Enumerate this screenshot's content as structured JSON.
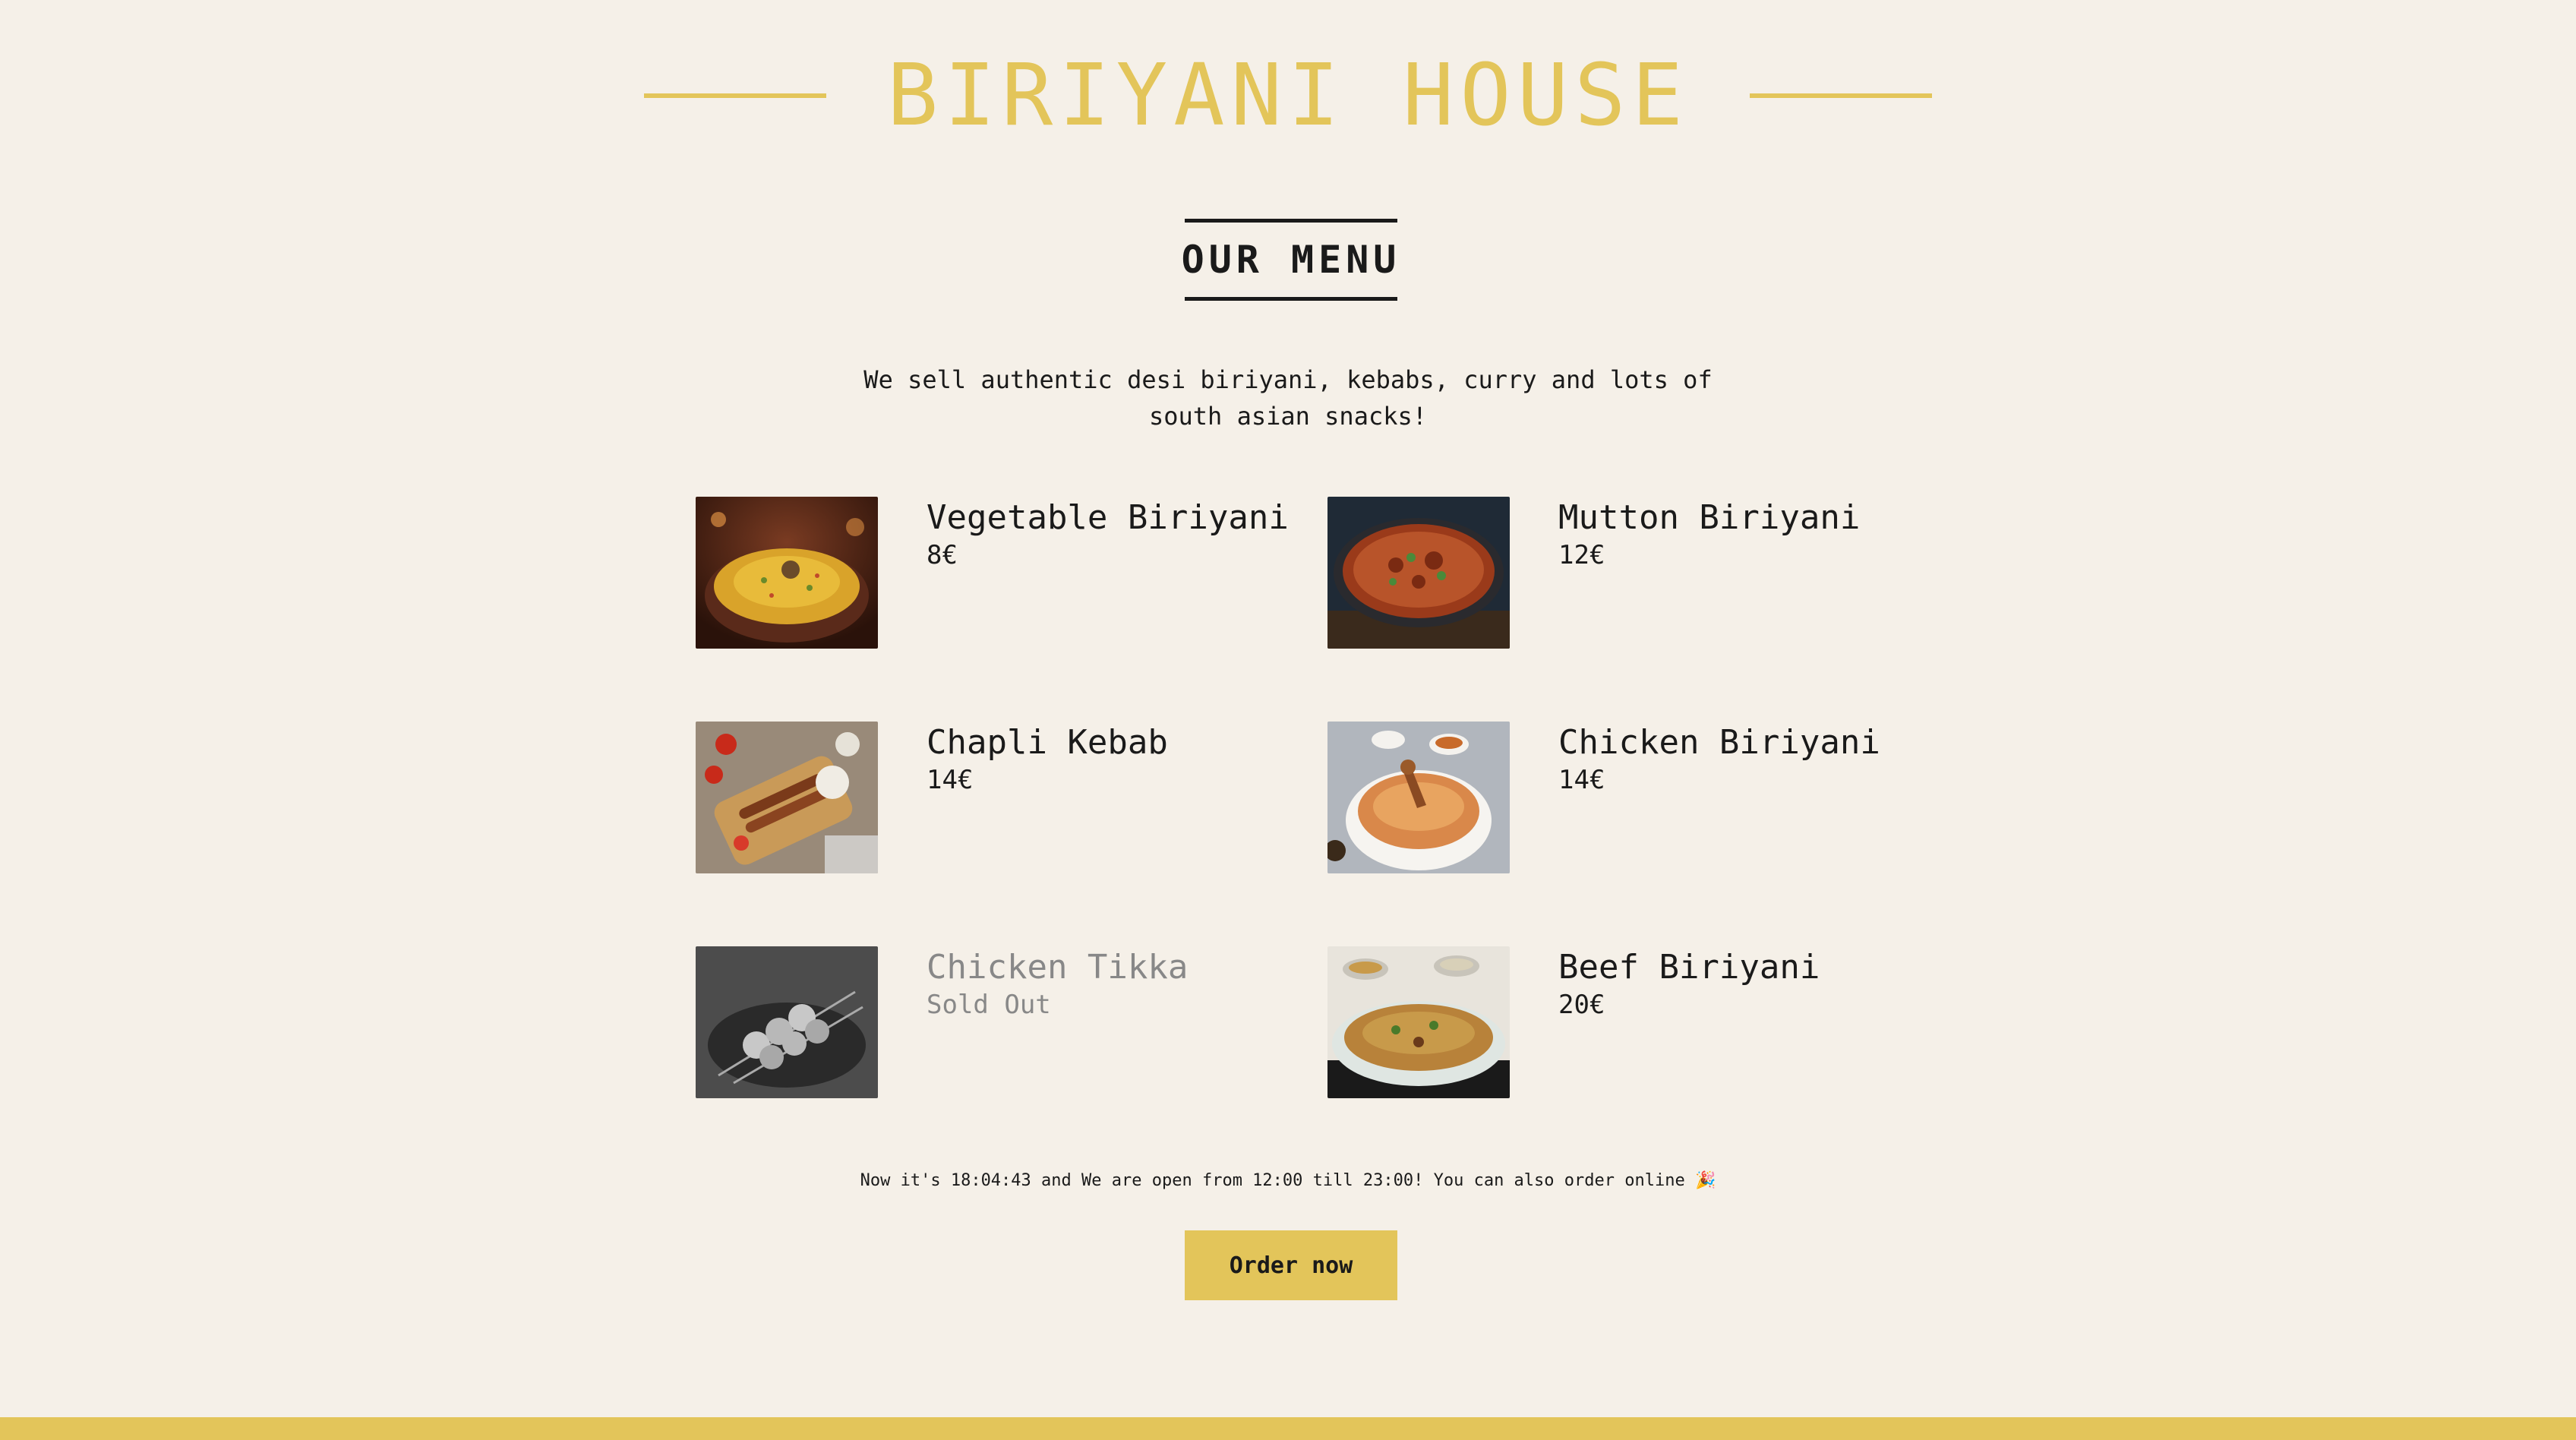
{
  "brand": {
    "title": "BIRIYANI HOUSE",
    "accent_color": "#e3c55a"
  },
  "menu_section": {
    "heading": "OUR MENU",
    "intro": "We sell authentic desi biriyani, kebabs, curry and lots of south asian snacks!"
  },
  "menu_items": [
    {
      "name": "Vegetable Biriyani",
      "price": "8€",
      "image": "vegetable-biriyani-photo",
      "available": true
    },
    {
      "name": "Mutton Biriyani",
      "price": "12€",
      "image": "mutton-biriyani-photo",
      "available": true
    },
    {
      "name": "Chapli Kebab",
      "price": "14€",
      "image": "chapli-kebab-photo",
      "available": true
    },
    {
      "name": "Chicken Biriyani",
      "price": "14€",
      "image": "chicken-biriyani-photo",
      "available": true
    },
    {
      "name": "Chicken Tikka",
      "price": "Sold Out",
      "image": "chicken-tikka-photo",
      "available": false
    },
    {
      "name": "Beef Biriyani",
      "price": "20€",
      "image": "beef-biriyani-photo",
      "available": true
    }
  ],
  "footer": {
    "note": "Now it's 18:04:43 and We are open from 12:00 till 23:00! You can also order online 🎉",
    "order_button": "Order now"
  }
}
